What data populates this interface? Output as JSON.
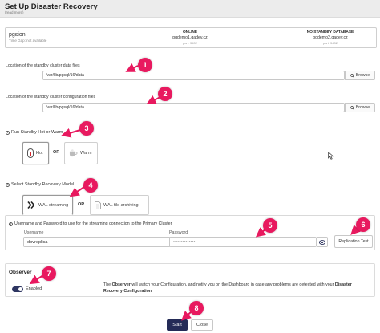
{
  "header": {
    "title": "Set Up Disaster Recovery",
    "read_more": "(read more)"
  },
  "cluster": {
    "name": "pgsion",
    "gap_text": "Time Gap: not available",
    "online": {
      "status": "ONLINE",
      "host": "pgdemo1.qadev.cz",
      "port": "port: 5432"
    },
    "standby": {
      "status": "NO STANDBY DATABASE",
      "host": "pgdemo2.qadev.cz",
      "port": "port: 5432"
    }
  },
  "data_files": {
    "label": "Location of the standby cluster data files",
    "value": "/var/lib/pgsql/16/data",
    "browse_label": "Browse"
  },
  "config_files": {
    "label": "Location of the standby cluster configuration files",
    "value": "/var/lib/pgsql/16/data",
    "browse_label": "Browse"
  },
  "standby_mode": {
    "title": "Run Standby Hot or Warm",
    "hot_label": "Hot",
    "or_label": "OR",
    "warm_label": "Warm"
  },
  "recovery_model": {
    "title": "Select Standby Recovery Model",
    "wal_streaming_label": "WAL streaming",
    "or_label": "OR",
    "wal_archiving_label": "WAL file archiving"
  },
  "streaming": {
    "description": "Username and Password to use for the streaming connection to the Primary Cluster",
    "username_label": "Username",
    "username_value": "dbvreplica",
    "password_label": "Password",
    "password_value": "••••••••••••••",
    "replication_test_label": "Replication Test"
  },
  "observer": {
    "title": "Observer",
    "toggle_label": "Enabled",
    "desc_prefix": "The ",
    "desc_bold1": "Observer",
    "desc_middle": " will watch your Configuration, and notify you on the Dashboard in case any problems are detected with your ",
    "desc_bold2": "Disaster Recovery Configuration",
    "desc_suffix": "."
  },
  "footer": {
    "start_label": "Start",
    "close_label": "Close"
  },
  "annotations": [
    "1",
    "2",
    "3",
    "4",
    "5",
    "6",
    "7",
    "8"
  ],
  "colors": {
    "accent": "#242b57",
    "badge": "#e8195f",
    "hot_red": "#d2232a"
  }
}
